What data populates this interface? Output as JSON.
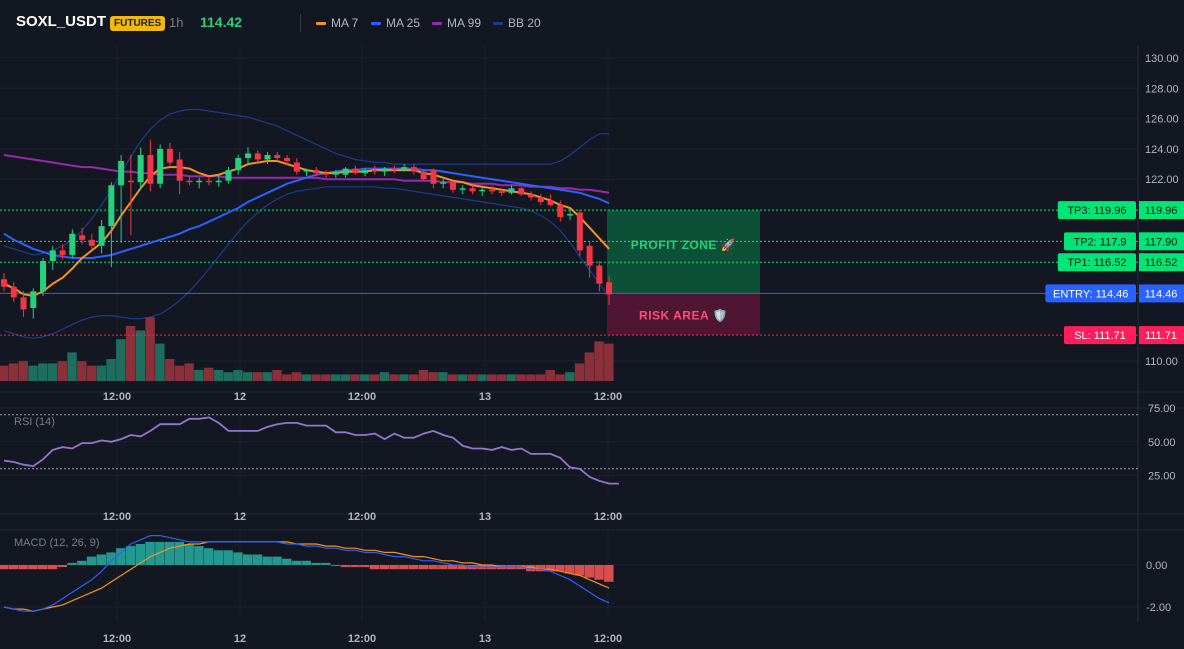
{
  "header": {
    "symbol": "SOXL_USDT",
    "badge": "FUTURES",
    "interval": "1h",
    "last_price": "114.42",
    "legend": [
      {
        "label": "MA 7",
        "color": "#f7931a"
      },
      {
        "label": "MA 25",
        "color": "#2962ff"
      },
      {
        "label": "MA 99",
        "color": "#9c27b0"
      },
      {
        "label": "BB 20",
        "color": "#1e3a8a"
      }
    ]
  },
  "colors": {
    "up": "#26d07c",
    "down": "#f23645",
    "volume_up": "#1e6e5e",
    "volume_down": "#8b2f3a",
    "rsi": "#9575cd",
    "macd_line": "#2962ff",
    "signal_line": "#f7931a",
    "hist_up": "#26a69a",
    "hist_down": "#ef5350",
    "entry": "#2962ff",
    "tp": "#00e676",
    "sl": "#ff1e5a"
  },
  "chart_data": [
    {
      "type": "candlestick",
      "panel": "price",
      "x_tick_labels": [
        "12:00",
        "12",
        "12:00",
        "13",
        "12:00"
      ],
      "y_ticks": [
        "130.00",
        "128.00",
        "126.00",
        "124.00",
        "122.00",
        "110.00"
      ],
      "ylim": [
        109.0,
        130.5
      ],
      "candles": [
        {
          "o": 115.4,
          "h": 115.8,
          "l": 114.6,
          "c": 114.9
        },
        {
          "o": 114.9,
          "h": 115.2,
          "l": 113.9,
          "c": 114.2
        },
        {
          "o": 114.2,
          "h": 114.6,
          "l": 112.9,
          "c": 113.4
        },
        {
          "o": 113.5,
          "h": 114.8,
          "l": 112.8,
          "c": 114.6
        },
        {
          "o": 114.6,
          "h": 116.8,
          "l": 114.3,
          "c": 116.6
        },
        {
          "o": 116.6,
          "h": 117.6,
          "l": 116.0,
          "c": 117.3
        },
        {
          "o": 117.3,
          "h": 117.7,
          "l": 116.7,
          "c": 117.0
        },
        {
          "o": 117.0,
          "h": 118.7,
          "l": 116.8,
          "c": 118.4
        },
        {
          "o": 118.3,
          "h": 118.8,
          "l": 117.7,
          "c": 118.0
        },
        {
          "o": 118.0,
          "h": 118.4,
          "l": 117.4,
          "c": 117.6
        },
        {
          "o": 117.6,
          "h": 119.3,
          "l": 117.1,
          "c": 118.9
        },
        {
          "o": 118.9,
          "h": 121.8,
          "l": 116.2,
          "c": 121.6
        },
        {
          "o": 121.6,
          "h": 123.6,
          "l": 117.8,
          "c": 123.2
        },
        {
          "o": 121.9,
          "h": 123.6,
          "l": 118.3,
          "c": 121.8
        },
        {
          "o": 121.8,
          "h": 124.1,
          "l": 121.3,
          "c": 123.6
        },
        {
          "o": 123.6,
          "h": 124.6,
          "l": 121.2,
          "c": 121.7
        },
        {
          "o": 121.7,
          "h": 124.3,
          "l": 121.4,
          "c": 124.0
        },
        {
          "o": 124.0,
          "h": 124.4,
          "l": 122.9,
          "c": 123.1
        },
        {
          "o": 123.3,
          "h": 123.8,
          "l": 121.0,
          "c": 121.9
        },
        {
          "o": 121.9,
          "h": 122.2,
          "l": 121.6,
          "c": 121.8
        },
        {
          "o": 121.8,
          "h": 122.1,
          "l": 121.4,
          "c": 121.9
        },
        {
          "o": 121.9,
          "h": 122.2,
          "l": 121.6,
          "c": 121.8
        },
        {
          "o": 121.8,
          "h": 122.3,
          "l": 121.5,
          "c": 121.9
        },
        {
          "o": 121.9,
          "h": 122.8,
          "l": 121.7,
          "c": 122.6
        },
        {
          "o": 122.6,
          "h": 123.6,
          "l": 122.3,
          "c": 123.4
        },
        {
          "o": 123.4,
          "h": 124.1,
          "l": 122.9,
          "c": 123.7
        },
        {
          "o": 123.7,
          "h": 123.9,
          "l": 123.1,
          "c": 123.3
        },
        {
          "o": 123.3,
          "h": 123.8,
          "l": 123.0,
          "c": 123.6
        },
        {
          "o": 123.6,
          "h": 123.8,
          "l": 123.2,
          "c": 123.4
        },
        {
          "o": 123.4,
          "h": 123.6,
          "l": 122.9,
          "c": 123.2
        },
        {
          "o": 123.1,
          "h": 123.4,
          "l": 122.3,
          "c": 122.5
        },
        {
          "o": 122.5,
          "h": 122.7,
          "l": 122.2,
          "c": 122.6
        },
        {
          "o": 122.6,
          "h": 122.8,
          "l": 122.2,
          "c": 122.4
        },
        {
          "o": 122.4,
          "h": 122.6,
          "l": 122.1,
          "c": 122.3
        },
        {
          "o": 122.3,
          "h": 122.6,
          "l": 122.1,
          "c": 122.5
        },
        {
          "o": 122.3,
          "h": 122.8,
          "l": 122.1,
          "c": 122.7
        },
        {
          "o": 122.7,
          "h": 122.9,
          "l": 122.3,
          "c": 122.4
        },
        {
          "o": 122.4,
          "h": 122.7,
          "l": 122.2,
          "c": 122.6
        },
        {
          "o": 122.6,
          "h": 122.9,
          "l": 122.3,
          "c": 122.5
        },
        {
          "o": 122.5,
          "h": 122.8,
          "l": 122.2,
          "c": 122.7
        },
        {
          "o": 122.7,
          "h": 122.9,
          "l": 122.4,
          "c": 122.6
        },
        {
          "o": 122.6,
          "h": 123.0,
          "l": 122.5,
          "c": 122.8
        },
        {
          "o": 122.8,
          "h": 123.0,
          "l": 122.3,
          "c": 122.5
        },
        {
          "o": 122.5,
          "h": 122.6,
          "l": 121.9,
          "c": 122.0
        },
        {
          "o": 122.6,
          "h": 122.7,
          "l": 121.4,
          "c": 121.7
        },
        {
          "o": 121.7,
          "h": 122.0,
          "l": 121.4,
          "c": 121.8
        },
        {
          "o": 121.8,
          "h": 121.9,
          "l": 121.1,
          "c": 121.3
        },
        {
          "o": 121.3,
          "h": 121.6,
          "l": 121.0,
          "c": 121.4
        },
        {
          "o": 121.4,
          "h": 121.6,
          "l": 121.0,
          "c": 121.2
        },
        {
          "o": 121.2,
          "h": 121.5,
          "l": 120.9,
          "c": 121.3
        },
        {
          "o": 121.3,
          "h": 121.6,
          "l": 121.0,
          "c": 121.2
        },
        {
          "o": 121.2,
          "h": 121.4,
          "l": 120.9,
          "c": 121.1
        },
        {
          "o": 121.1,
          "h": 121.6,
          "l": 121.0,
          "c": 121.4
        },
        {
          "o": 121.4,
          "h": 121.5,
          "l": 120.9,
          "c": 121.0
        },
        {
          "o": 121.0,
          "h": 121.2,
          "l": 120.6,
          "c": 120.8
        },
        {
          "o": 120.8,
          "h": 121.0,
          "l": 120.3,
          "c": 120.5
        },
        {
          "o": 120.6,
          "h": 121.0,
          "l": 120.2,
          "c": 120.3
        },
        {
          "o": 120.3,
          "h": 120.6,
          "l": 119.2,
          "c": 119.5
        },
        {
          "o": 119.6,
          "h": 120.0,
          "l": 119.3,
          "c": 119.7
        },
        {
          "o": 119.8,
          "h": 120.0,
          "l": 116.9,
          "c": 117.3
        },
        {
          "o": 117.6,
          "h": 117.9,
          "l": 115.5,
          "c": 116.3
        },
        {
          "o": 116.3,
          "h": 116.6,
          "l": 114.6,
          "c": 115.1
        },
        {
          "o": 115.2,
          "h": 115.6,
          "l": 113.7,
          "c": 114.4
        }
      ],
      "ma7": [
        115.1,
        114.8,
        114.4,
        114.3,
        114.6,
        115.1,
        115.5,
        116.1,
        116.8,
        117.3,
        117.8,
        118.6,
        119.6,
        120.5,
        121.4,
        122.2,
        122.7,
        122.8,
        122.8,
        122.7,
        122.4,
        122.2,
        122.3,
        122.5,
        122.7,
        123.0,
        123.1,
        123.2,
        123.2,
        123.0,
        122.8,
        122.6,
        122.5,
        122.4,
        122.4,
        122.5,
        122.5,
        122.5,
        122.6,
        122.6,
        122.6,
        122.6,
        122.6,
        122.4,
        122.3,
        122.1,
        121.9,
        121.8,
        121.6,
        121.5,
        121.4,
        121.3,
        121.2,
        121.1,
        121.0,
        120.8,
        120.6,
        120.3,
        120.1,
        119.5,
        118.8,
        118.1,
        117.4
      ],
      "ma25": [
        118.4,
        118.0,
        117.7,
        117.4,
        117.2,
        117.0,
        116.9,
        116.8,
        116.8,
        116.8,
        116.9,
        117.0,
        117.2,
        117.4,
        117.6,
        117.8,
        118.0,
        118.2,
        118.4,
        118.7,
        118.9,
        119.2,
        119.5,
        119.8,
        120.1,
        120.5,
        120.8,
        121.1,
        121.4,
        121.7,
        121.9,
        122.1,
        122.3,
        122.4,
        122.5,
        122.6,
        122.6,
        122.7,
        122.7,
        122.7,
        122.7,
        122.7,
        122.7,
        122.6,
        122.6,
        122.5,
        122.4,
        122.3,
        122.2,
        122.1,
        122.0,
        121.9,
        121.8,
        121.7,
        121.6,
        121.5,
        121.4,
        121.3,
        121.2,
        121.1,
        120.9,
        120.7,
        120.4
      ],
      "ma99": [
        123.6,
        123.5,
        123.4,
        123.3,
        123.2,
        123.1,
        123.0,
        122.9,
        122.8,
        122.8,
        122.7,
        122.6,
        122.5,
        122.5,
        122.4,
        122.4,
        122.3,
        122.3,
        122.3,
        122.2,
        122.2,
        122.2,
        122.2,
        122.1,
        122.1,
        122.1,
        122.1,
        122.1,
        122.1,
        122.1,
        122.1,
        122.1,
        122.1,
        122.0,
        122.0,
        122.0,
        122.0,
        122.0,
        122.0,
        122.0,
        122.0,
        121.9,
        121.9,
        121.9,
        121.9,
        121.8,
        121.8,
        121.8,
        121.7,
        121.7,
        121.7,
        121.6,
        121.6,
        121.6,
        121.5,
        121.5,
        121.5,
        121.4,
        121.4,
        121.3,
        121.3,
        121.2,
        121.1
      ],
      "bb_upper": [
        117.6,
        117.4,
        117.2,
        117.0,
        117.1,
        117.3,
        117.6,
        118.0,
        118.6,
        119.4,
        120.3,
        121.3,
        122.4,
        123.5,
        124.5,
        125.3,
        125.9,
        126.3,
        126.5,
        126.6,
        126.6,
        126.5,
        126.4,
        126.3,
        126.2,
        126.1,
        125.9,
        125.7,
        125.5,
        125.2,
        124.9,
        124.6,
        124.3,
        124.0,
        123.7,
        123.5,
        123.3,
        123.2,
        123.1,
        123.1,
        123.0,
        123.0,
        123.0,
        123.0,
        123.0,
        123.0,
        123.0,
        123.0,
        123.0,
        123.0,
        123.0,
        123.0,
        123.0,
        123.0,
        123.0,
        123.0,
        123.0,
        123.2,
        123.6,
        124.1,
        124.6,
        125.0,
        125.0
      ],
      "bb_lower": [
        112.0,
        111.8,
        111.6,
        111.5,
        111.6,
        111.8,
        112.1,
        112.4,
        112.7,
        112.9,
        113.0,
        113.0,
        112.9,
        112.8,
        112.8,
        112.9,
        113.1,
        113.5,
        114.0,
        114.6,
        115.3,
        116.1,
        116.9,
        117.7,
        118.5,
        119.2,
        119.8,
        120.3,
        120.7,
        121.0,
        121.2,
        121.3,
        121.4,
        121.5,
        121.5,
        121.5,
        121.5,
        121.5,
        121.5,
        121.4,
        121.4,
        121.3,
        121.2,
        121.1,
        121.0,
        120.9,
        120.8,
        120.7,
        120.6,
        120.5,
        120.4,
        120.3,
        120.2,
        120.1,
        119.9,
        119.6,
        119.2,
        118.6,
        117.8,
        116.9,
        116.0,
        115.1,
        114.2
      ],
      "volume": [
        7,
        8,
        9,
        7,
        8,
        8,
        9,
        13,
        9,
        7,
        7,
        10,
        19,
        25,
        23,
        29,
        17,
        10,
        7,
        8,
        5,
        6,
        5,
        4,
        5,
        4,
        4,
        4,
        5,
        3,
        4,
        3,
        3,
        3,
        3,
        3,
        3,
        3,
        3,
        4,
        3,
        3,
        3,
        5,
        4,
        4,
        3,
        3,
        3,
        3,
        3,
        3,
        3,
        3,
        3,
        3,
        5,
        3,
        4,
        8,
        13,
        18,
        17
      ],
      "levels": [
        {
          "name": "tp3",
          "label": "TP3: 119.96",
          "axis": "119.96",
          "value": 119.96
        },
        {
          "name": "tp2",
          "label": "TP2: 117.9",
          "axis": "117.90",
          "value": 117.9
        },
        {
          "name": "tp1",
          "label": "TP1: 116.52",
          "axis": "116.52",
          "value": 116.52
        },
        {
          "name": "entry",
          "label": "ENTRY: 114.46",
          "axis": "114.46",
          "value": 114.46
        },
        {
          "name": "sl",
          "label": "SL: 111.71",
          "axis": "111.71",
          "value": 111.71
        }
      ],
      "zones": {
        "profit_label": "PROFIT ZONE 🚀",
        "risk_label": "RISK AREA 🛡️"
      }
    },
    {
      "type": "line",
      "panel": "rsi",
      "title": "RSI (14)",
      "y_ticks": [
        "75.00",
        "50.00",
        "25.00"
      ],
      "ylim": [
        10,
        80
      ],
      "guide_levels": [
        70,
        30
      ],
      "values": [
        36,
        35,
        33,
        32,
        37,
        44,
        46,
        45,
        49,
        49,
        51,
        50,
        52,
        55,
        54,
        58,
        63,
        63,
        63,
        67,
        67,
        68,
        64,
        58,
        58,
        58,
        58,
        61,
        63,
        64,
        64,
        62,
        62,
        62,
        57,
        57,
        55,
        55,
        56,
        52,
        56,
        53,
        53,
        56,
        58,
        55,
        53,
        47,
        45,
        45,
        44,
        46,
        44,
        45,
        41,
        41,
        41,
        38,
        31,
        30,
        24,
        21,
        19,
        19
      ]
    },
    {
      "type": "bar",
      "panel": "macd",
      "title": "MACD (12, 26, 9)",
      "y_ticks": [
        "0.00",
        "-2.00"
      ],
      "ylim": [
        -2.8,
        2.0
      ],
      "hist": [
        -0.2,
        -0.2,
        -0.2,
        -0.2,
        -0.2,
        -0.2,
        -0.1,
        0.1,
        0.2,
        0.4,
        0.5,
        0.6,
        0.8,
        0.9,
        1.0,
        1.1,
        1.1,
        1.1,
        1.1,
        1.0,
        0.9,
        0.8,
        0.7,
        0.7,
        0.6,
        0.5,
        0.5,
        0.4,
        0.4,
        0.3,
        0.2,
        0.2,
        0.1,
        0.1,
        0.0,
        -0.1,
        -0.1,
        -0.1,
        -0.2,
        -0.2,
        -0.2,
        -0.2,
        -0.2,
        -0.2,
        -0.2,
        -0.2,
        -0.2,
        -0.2,
        -0.2,
        -0.2,
        -0.2,
        -0.2,
        -0.2,
        -0.2,
        -0.3,
        -0.3,
        -0.3,
        -0.3,
        -0.4,
        -0.5,
        -0.6,
        -0.7,
        -0.8
      ],
      "macd": [
        -2.0,
        -2.1,
        -2.2,
        -2.2,
        -2.1,
        -1.9,
        -1.6,
        -1.3,
        -1.0,
        -0.7,
        -0.3,
        0.2,
        0.6,
        1.0,
        1.2,
        1.4,
        1.4,
        1.3,
        1.2,
        1.1,
        1.1,
        1.1,
        1.1,
        1.1,
        1.1,
        1.1,
        1.1,
        1.1,
        1.1,
        1.0,
        1.0,
        0.9,
        0.9,
        0.8,
        0.8,
        0.7,
        0.7,
        0.6,
        0.6,
        0.5,
        0.4,
        0.4,
        0.3,
        0.2,
        0.2,
        0.1,
        0.0,
        0.0,
        -0.1,
        -0.1,
        -0.1,
        -0.1,
        -0.1,
        -0.1,
        -0.2,
        -0.2,
        -0.3,
        -0.5,
        -0.7,
        -1.0,
        -1.3,
        -1.6,
        -1.8
      ],
      "signal": [
        -2.0,
        -2.1,
        -2.1,
        -2.2,
        -2.1,
        -2.0,
        -1.9,
        -1.7,
        -1.5,
        -1.3,
        -1.1,
        -0.8,
        -0.5,
        -0.2,
        0.1,
        0.4,
        0.6,
        0.8,
        0.9,
        1.0,
        1.0,
        1.1,
        1.1,
        1.1,
        1.1,
        1.1,
        1.1,
        1.1,
        1.1,
        1.1,
        1.0,
        1.0,
        1.0,
        0.9,
        0.9,
        0.8,
        0.8,
        0.7,
        0.7,
        0.6,
        0.6,
        0.5,
        0.4,
        0.4,
        0.3,
        0.2,
        0.2,
        0.1,
        0.1,
        0.0,
        0.0,
        -0.1,
        -0.1,
        -0.1,
        -0.1,
        -0.2,
        -0.2,
        -0.3,
        -0.4,
        -0.5,
        -0.7,
        -0.9,
        -1.1
      ]
    }
  ]
}
